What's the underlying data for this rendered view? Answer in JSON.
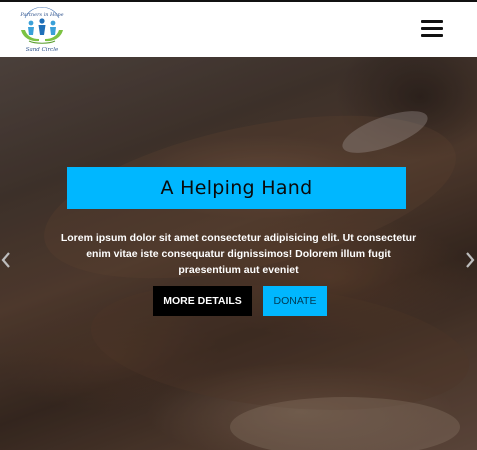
{
  "header": {
    "logo": {
      "line1": "Partners in Hope",
      "line2": "Sand Circle",
      "icon": "people-in-hands-logo"
    },
    "menu_icon": "hamburger-icon"
  },
  "hero": {
    "title": "A Helping Hand",
    "text": "Lorem ipsum dolor sit amet consectetur adipisicing elit. Ut consectetur enim vitae iste consequatur dignissimos! Dolorem illum fugit praesentium aut eveniet",
    "primary_button": "MORE DETAILS",
    "secondary_button": "DONATE",
    "prev_icon": "chevron-left-icon",
    "next_icon": "chevron-right-icon",
    "background_image": "hands-holding-photo"
  },
  "colors": {
    "accent": "#00b7ff",
    "dark_button": "#000000",
    "header_bg": "#ffffff"
  }
}
